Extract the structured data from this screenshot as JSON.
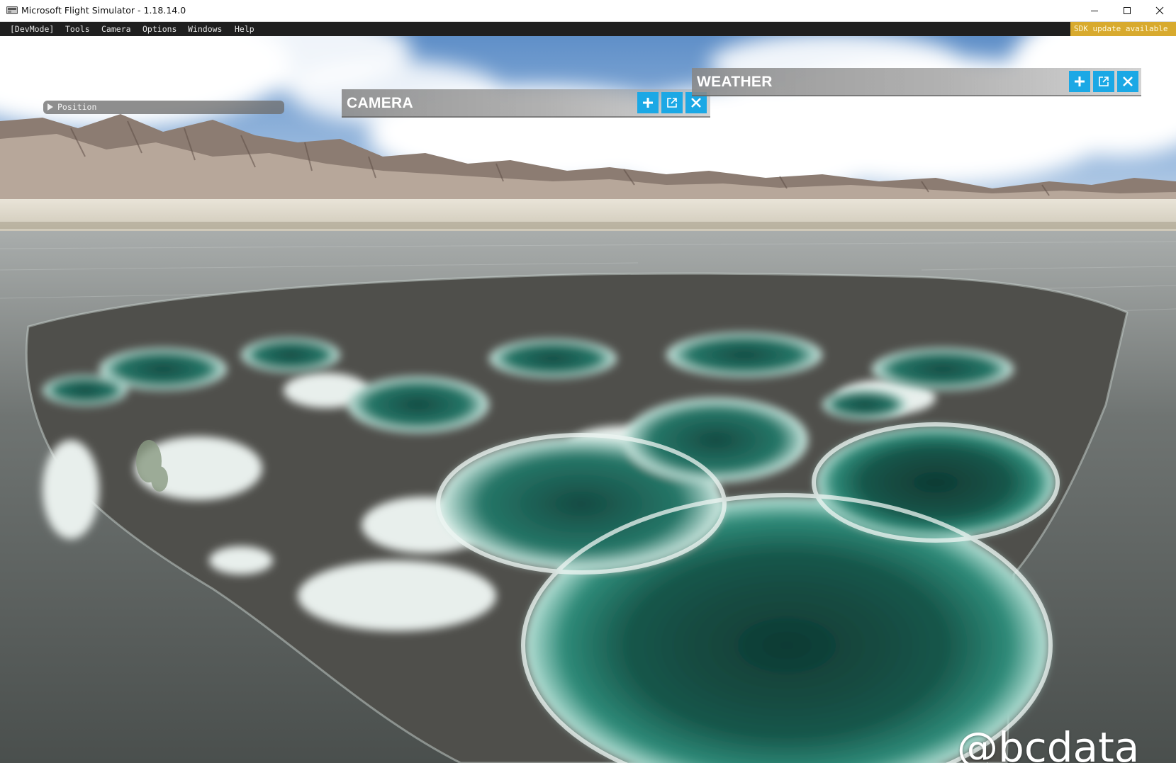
{
  "window": {
    "title": "Microsoft Flight Simulator - 1.18.14.0",
    "app_icon": "flight-simulator-app-icon",
    "controls": [
      "minimize-icon",
      "maximize-icon",
      "close-icon"
    ]
  },
  "dev_menu": {
    "items": [
      {
        "label": "[DevMode]"
      },
      {
        "label": "Tools"
      },
      {
        "label": "Camera"
      },
      {
        "label": "Options"
      },
      {
        "label": "Windows"
      },
      {
        "label": "Help"
      }
    ],
    "sdk_notice": "SDK update available",
    "sdk_notice_color": "#d8aa2e"
  },
  "position_panel": {
    "label": "Position",
    "expanded": false,
    "icon": "collapsed-arrow-icon"
  },
  "camera_panel": {
    "title": "CAMERA",
    "buttons": [
      "plus-icon",
      "pop-out-icon",
      "close-icon"
    ]
  },
  "weather_panel": {
    "title": "WEATHER",
    "buttons": [
      "plus-icon",
      "pop-out-icon",
      "close-icon"
    ]
  },
  "theme": {
    "panel_button_color": "#1ba8e5",
    "menu_bar_color": "#1f1f1f"
  },
  "watermark": "@bcdata"
}
